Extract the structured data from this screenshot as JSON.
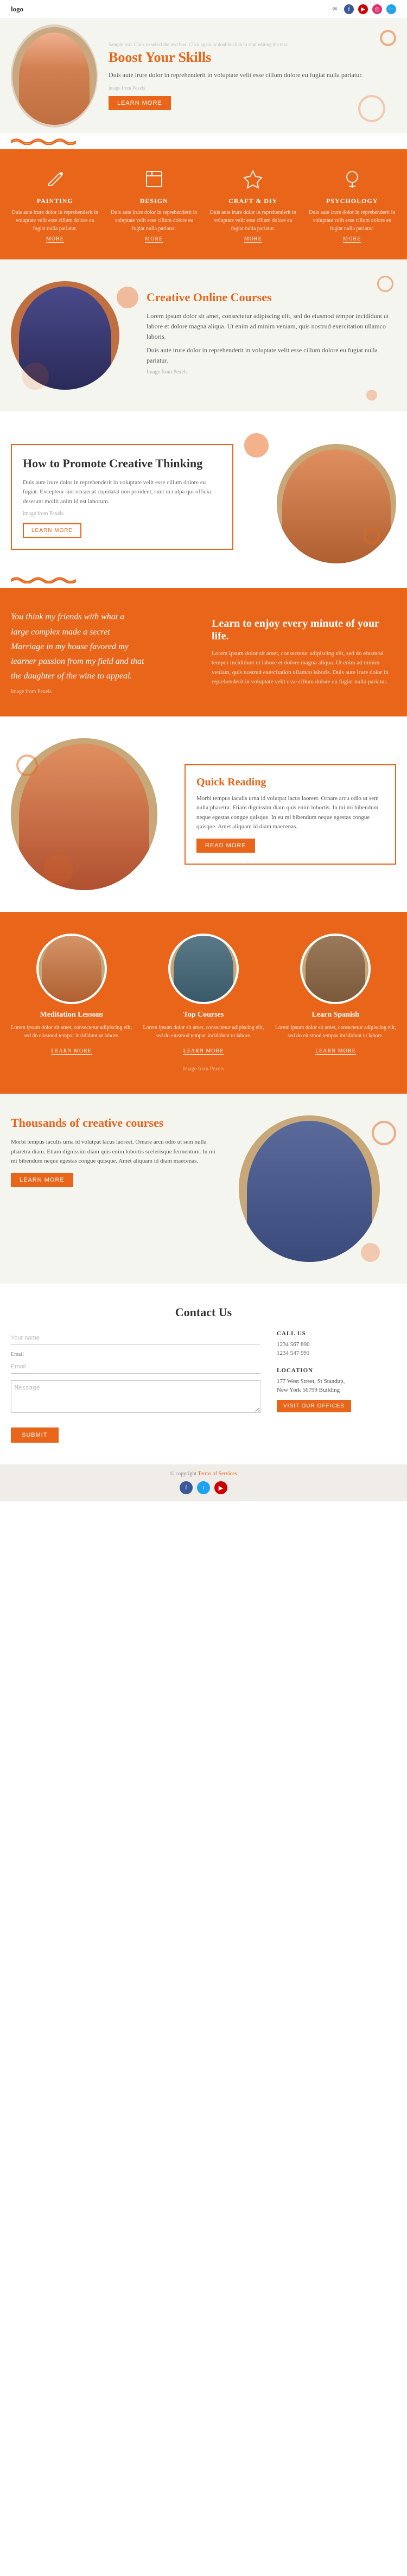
{
  "nav": {
    "logo": "logo",
    "icons": [
      "facebook",
      "youtube",
      "instagram",
      "twitter"
    ]
  },
  "hero": {
    "sample_text": "Sample text. Click to select the text box. Click again or double-click to start editing the text.",
    "title": "Boost Your Skills",
    "description": "Duis aute irure dolor in reprehenderit in voluptate velit esse cillum dolore eu fugiat nulla pariatur.",
    "image_from": "image from Pexels",
    "btn_label": "LEARN MORE"
  },
  "skills": {
    "items": [
      {
        "title": "PAINTING",
        "text": "Duis aute irure dolor in reprehenderit in voluptate velit esse cillum dolore eu fugiat nulla pariatur.",
        "link": "MORE"
      },
      {
        "title": "DESIGN",
        "text": "Duis aute irure dolor in reprehenderit in voluptate velit esse cillum dolore eu fugiat nulla pariatur.",
        "link": "MORE"
      },
      {
        "title": "CRAFT & DIY",
        "text": "Duis aute irure dolor in reprehenderit in voluptate velit esse cillum dolore eu fugiat nulla pariatur.",
        "link": "MORE"
      },
      {
        "title": "PSYCHOLOGY",
        "text": "Duis aute irure dolor in reprehenderit in voluptate velit esse cillum dolore eu fugiat nulla pariatur.",
        "link": "MORE"
      }
    ]
  },
  "creative_online": {
    "title": "Creative Online Courses",
    "text1": "Lorem ipsum dolor sit amet, consectetur adipiscing elit, sed do eiusmod tempor incididunt ut labore et dolore magna aliqua. Ut enim ad minim veniam, quis nostrud exercitation ullamco laboris.",
    "text2": "Duis aute irure dolor in reprehenderit in voluptate velit esse cillum dolore eu fugiat nulla pariatur.",
    "image_from": "Image from Pexels"
  },
  "promote": {
    "title": "How to Promote Creative Thinking",
    "text": "Duis aute irure dolor in reprehenderit in voluptate velit esse cillum dolore eu fugiat. Excepteur sint occaecat cupidatat non proident, sunt in culpa qui officia deserunt mollit anim id est laborum.",
    "sample": "image from Pexels",
    "btn_label": "LEARN MORE"
  },
  "enjoy": {
    "quote_line1": "You think my friends with what a",
    "quote_line2": "large complex made a secret",
    "quote_line3": "Marriage in my house favored my",
    "quote_line4": "learner passion from my field and that",
    "quote_line5": "the daughter of the wine to appeal.",
    "image_from": "image from Pexels",
    "title": "Learn to enjoy every minute of your life.",
    "text": "Lorem ipsum dolor sit amet, consectetur adipiscing elit, sed do eiusmod tempor incididunt ut labore et dolore magna aliqua. Ut enim ad minim veniam, quis nostrud exercitation ullamco laboris. Duis aute irure dolor in reprehenderit in voluptate velit esse cillum dolore eu fugiat nulla pariatur."
  },
  "quick": {
    "title": "Quick Reading",
    "text": "Morbi tempus iaculis urna id volutpat lacus laoreet. Ornare arcu odio ut sem nulla pharetra. Etiam dignissim diam quis enim lobortis. In mi mi bibendum neque egestas congue quisque. In eu mi bibendum neque egestas congue quisque. Amet aliquam id diam maecenas.",
    "btn_label": "READ MORE"
  },
  "courses": {
    "items": [
      {
        "title": "Meditation Lessons",
        "text": "Lorem ipsum dolor sit amet, consectetur adipiscing elit, sed do eiusmod tempor incididunt ut labore.",
        "link": "LEARN MORE",
        "person_color": "#d4956a"
      },
      {
        "title": "Top Courses",
        "text": "Lorem ipsum dolor sit amet, consectetur adipiscing elit, sed do eiusmod tempor incididunt ut labore.",
        "link": "LEARN MORE",
        "person_color": "#5a7a8a"
      },
      {
        "title": "Learn Spanish",
        "text": "Lorem ipsum dolor sit amet, consectetur adipiscing elit, sed do eiusmod tempor incididunt ut labore.",
        "link": "LEARN MORE",
        "person_color": "#8a6a4a"
      }
    ],
    "image_from": "Image from Pexels"
  },
  "thousands": {
    "title": "Thousands of creative courses",
    "text": "Morbi tempus iaculis urna id volutpat lacus laoreet. Ornare arcu odio ut sem nulla pharetra diam. Etiam dignissim diam quis enim lobortis scelerisque fermentum. In mi mi bibendum neque egestas congue quisque. Amet aliquam id diam maecenas.",
    "btn_label": "LEARN MORE"
  },
  "contact": {
    "title": "Contact Us",
    "form": {
      "name_placeholder": "Your name",
      "email_label": "Email",
      "email_placeholder": "Email",
      "message_placeholder": "Message",
      "submit_label": "SUBMIT"
    },
    "call_us": {
      "title": "CALL US",
      "phone1": "1234 567 890",
      "phone2": "1234 547 991"
    },
    "location": {
      "title": "LOCATION",
      "address1": "177 West Street, St Standup,",
      "address2": "New York 56799 Building",
      "btn_label": "VISIT OUR OFFICES"
    }
  },
  "footer": {
    "copy_text": "© copyright",
    "terms_link": "Terms of Services",
    "socials": [
      "fb",
      "tw",
      "yt"
    ]
  }
}
